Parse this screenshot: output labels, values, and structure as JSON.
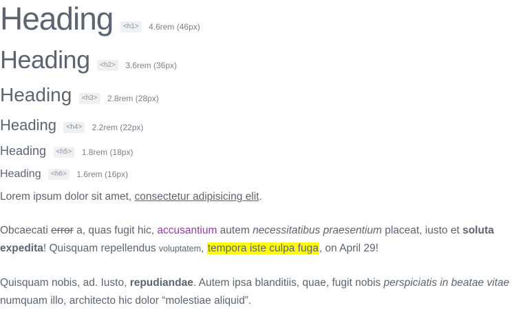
{
  "headings": [
    {
      "text": "Heading",
      "tag": "<h1>",
      "size": "4.6rem (46px)"
    },
    {
      "text": "Heading",
      "tag": "<h2>",
      "size": "3.6rem (36px)"
    },
    {
      "text": "Heading",
      "tag": "<h3>",
      "size": "2.8rem (28px)"
    },
    {
      "text": "Heading",
      "tag": "<h4>",
      "size": "2.2rem (22px)"
    },
    {
      "text": "Heading",
      "tag": "<h5>",
      "size": "1.8rem (18px)"
    },
    {
      "text": "Heading",
      "tag": "<h6>",
      "size": "1.6rem (16px)"
    }
  ],
  "p1": {
    "t1": "Lorem ipsum dolor sit amet, ",
    "underlined": "consectetur adipisicing elit",
    "t2": "."
  },
  "p2": {
    "t1": "Obcaecati ",
    "deleted": "error",
    "t2": " a, quas fugit hic, ",
    "link": "accusantium",
    "t3": " autem ",
    "italic": "necessitatibus praesentium",
    "t4": " placeat, iusto et ",
    "bold": "soluta expedita",
    "t5": "! Quisquam repellendus ",
    "small": "voluptatem",
    "t6": ", ",
    "highlight": "tempora iste culpa fuga",
    "t7": ", on April 29!"
  },
  "p3": {
    "t1": "Quisquam nobis, ad. Iusto, ",
    "bold": "repudiandae",
    "t2": ". Autem ipsa blanditiis, quae, fugit nobis ",
    "italic": "perspiciatis in beatae vitae",
    "t3": " numquam illo, architecto hic dolor “molestiae aliquid”."
  }
}
